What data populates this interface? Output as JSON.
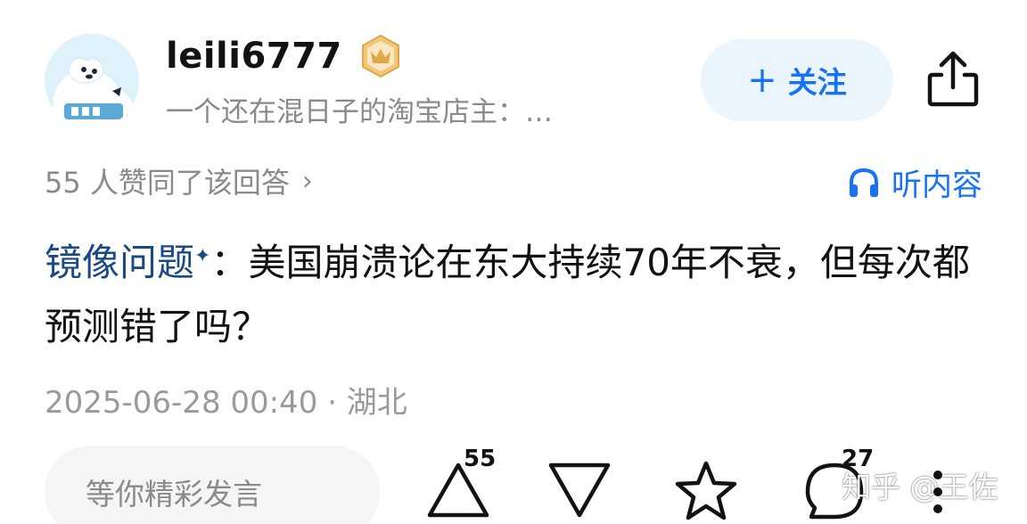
{
  "author": {
    "username": "leili6777",
    "bio": "一个还在混日子的淘宝店主：…",
    "follow_label": "关注",
    "follow_plus": "+"
  },
  "likes_text": "55 人赞同了该回答",
  "likes_chevron": "›",
  "listen_label": "听内容",
  "question": {
    "prefix": "镜像问题",
    "sparkle": "✦",
    "separator": "：",
    "text": "美国崩溃论在东大持续70年不衰，但每次都预测错了吗？"
  },
  "meta": "2025-06-28 00:40 · 湖北",
  "comment_placeholder": "等你精彩发言",
  "actions": {
    "upvote_count": "55",
    "comment_count": "27"
  },
  "watermark": "知乎 @王佐",
  "colors": {
    "accent": "#1772f6",
    "follow_bg": "#ebf5fd",
    "question_link": "#194a86",
    "muted": "#8a8a8a",
    "badge": "#e0a84a"
  }
}
